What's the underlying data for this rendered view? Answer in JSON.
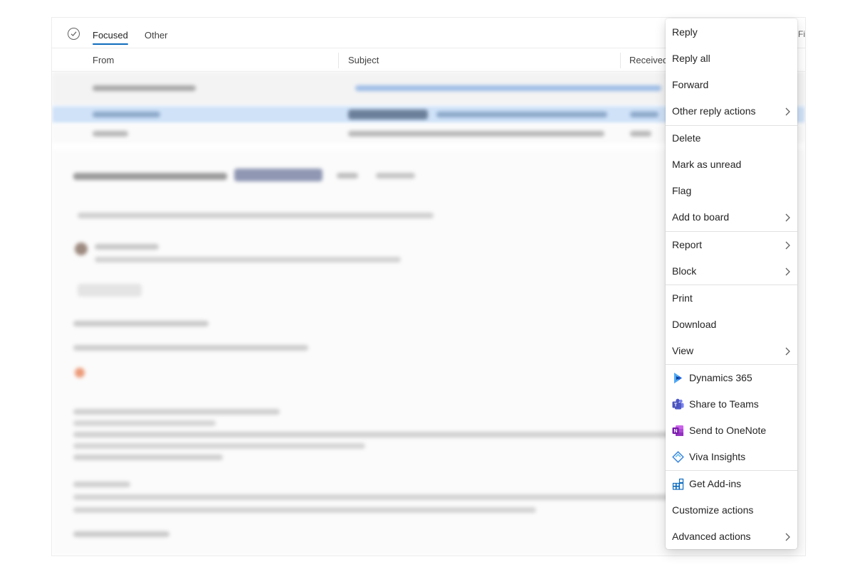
{
  "tabs": {
    "focused": "Focused",
    "other": "Other"
  },
  "columns": {
    "from": "From",
    "subject": "Subject",
    "received": "Received"
  },
  "clipped_text": "Fil",
  "accent_color": "#0f6cbd",
  "selected_row_color": "#cfe2f8",
  "menu": {
    "items": [
      {
        "label": "Reply",
        "submenu": false
      },
      {
        "label": "Reply all",
        "submenu": false
      },
      {
        "label": "Forward",
        "submenu": false
      },
      {
        "label": "Other reply actions",
        "submenu": true
      },
      {
        "label": "Delete",
        "submenu": false
      },
      {
        "label": "Mark as unread",
        "submenu": false
      },
      {
        "label": "Flag",
        "submenu": false
      },
      {
        "label": "Add to board",
        "submenu": true
      },
      {
        "label": "Report",
        "submenu": true
      },
      {
        "label": "Block",
        "submenu": true
      },
      {
        "label": "Print",
        "submenu": false
      },
      {
        "label": "Download",
        "submenu": false
      },
      {
        "label": "View",
        "submenu": true
      },
      {
        "label": "Dynamics 365",
        "submenu": false,
        "icon": "dynamics-365-icon"
      },
      {
        "label": "Share to Teams",
        "submenu": false,
        "icon": "teams-icon"
      },
      {
        "label": "Send to OneNote",
        "submenu": false,
        "icon": "onenote-icon"
      },
      {
        "label": "Viva Insights",
        "submenu": false,
        "icon": "viva-insights-icon"
      },
      {
        "label": "Get Add-ins",
        "submenu": false,
        "icon": "add-ins-icon"
      },
      {
        "label": "Customize actions",
        "submenu": false
      },
      {
        "label": "Advanced actions",
        "submenu": true
      }
    ]
  }
}
